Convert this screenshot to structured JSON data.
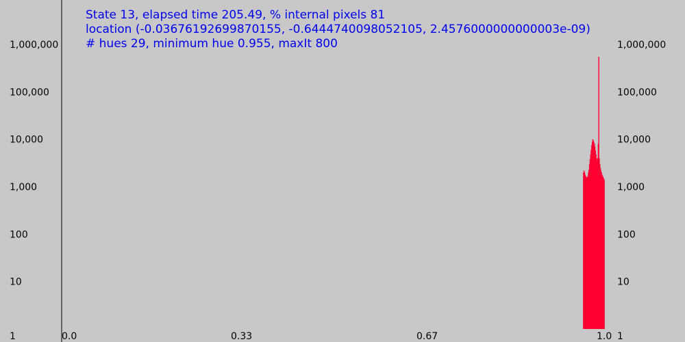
{
  "header": {
    "line1": "State 13, elapsed time 205.49, % internal pixels 81",
    "line2": "location (-0.03676192699870155, -0.6444740098052105, 2.4576000000000003e-09)",
    "line3": "# hues 29, minimum hue 0.955, maxIt 800"
  },
  "chart_data": {
    "type": "bar",
    "y_scale": "log",
    "ylim": [
      1,
      1000000
    ],
    "xlim": [
      0.0,
      1.0
    ],
    "y_tick_labels": [
      "1",
      "10",
      "100",
      "1,000",
      "10,000",
      "100,000",
      "1,000,000"
    ],
    "y_tick_values": [
      1,
      10,
      100,
      1000,
      10000,
      100000,
      1000000
    ],
    "x_tick_labels": [
      "0.0",
      "0.33",
      "0.67",
      "1.0"
    ],
    "x_tick_values": [
      0.0,
      0.33,
      0.67,
      1.0
    ],
    "bar_color": "#ff0033",
    "series": [
      {
        "x": [
          0.955,
          0.956,
          0.957,
          0.958,
          0.959,
          0.96,
          0.961,
          0.962,
          0.963,
          0.964,
          0.965,
          0.966,
          0.967,
          0.968,
          0.969,
          0.97,
          0.971,
          0.972,
          0.973,
          0.974,
          0.975,
          0.976,
          0.977,
          0.978,
          0.979,
          0.98,
          0.981,
          0.982,
          0.983,
          0.984,
          0.985,
          0.986,
          0.987,
          0.988,
          0.989,
          0.99,
          0.991,
          0.992,
          0.993
        ],
        "values": [
          2000,
          2200,
          2000,
          1800,
          1700,
          1600,
          1550,
          1600,
          1700,
          2000,
          2300,
          3000,
          3800,
          4800,
          6000,
          7500,
          8800,
          10000,
          9500,
          8800,
          8000,
          7000,
          5800,
          4800,
          4000,
          3500,
          4000,
          8000,
          550000,
          4000,
          3000,
          2500,
          2200,
          2000,
          1800,
          1700,
          1600,
          1500,
          1400
        ]
      }
    ]
  }
}
